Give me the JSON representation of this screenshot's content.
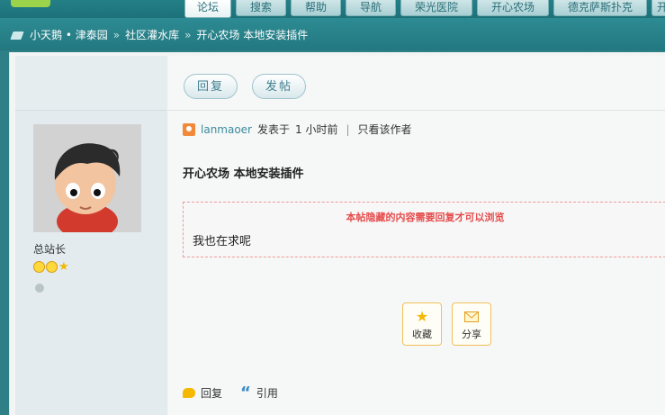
{
  "nav": {
    "tabs": [
      {
        "label": "论坛",
        "active": true
      },
      {
        "label": "搜索",
        "active": false
      },
      {
        "label": "帮助",
        "active": false
      },
      {
        "label": "导航",
        "active": false
      },
      {
        "label": "荣光医院",
        "active": false
      },
      {
        "label": "开心农场",
        "active": false
      },
      {
        "label": "德克萨斯扑克",
        "active": false
      },
      {
        "label": "开",
        "active": false
      }
    ]
  },
  "breadcrumb": {
    "items": [
      "小天鹅 • 津泰园",
      "社区灌水库",
      "开心农场 本地安装插件"
    ],
    "separator": "»"
  },
  "toolbar": {
    "reply_label": "回复",
    "post_label": "发帖"
  },
  "user": {
    "rank": "总站长"
  },
  "post": {
    "author": "lanmaoer",
    "posted": "发表于",
    "time": "1 小时前",
    "only_author": "只看该作者",
    "divider": "|",
    "title": "开心农场  本地安装插件",
    "hidden_notice": "本帖隐藏的内容需要回复才可以浏览",
    "body": "我也在求呢"
  },
  "actions": {
    "favorite": "收藏",
    "share": "分享",
    "reply": "回复",
    "quote": "引用"
  },
  "colors": {
    "accent": "#2a8088",
    "author": "#3a8c9c",
    "notice": "#e64b4b",
    "button_border": "#f0c05a"
  }
}
